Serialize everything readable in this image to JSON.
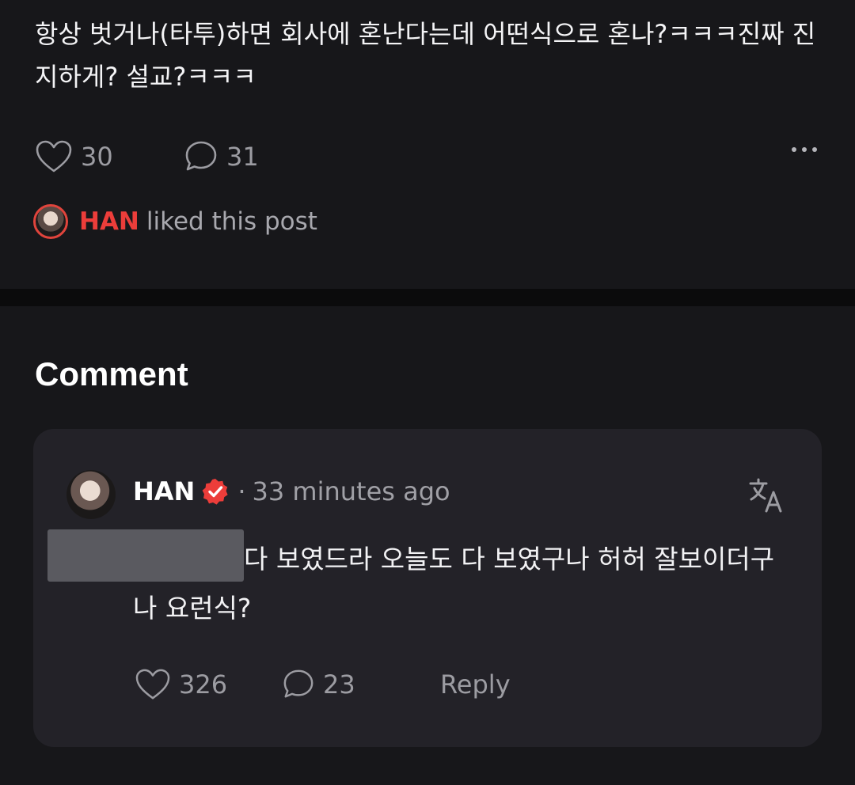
{
  "post": {
    "text": "항상 벗거나(타투)하면 회사에 혼난다는데 어떤식으로 혼나?ㅋㅋㅋ진짜 진지하게? 설교?ㅋㅋㅋ",
    "like_count": "30",
    "comment_count": "31",
    "liked_by": {
      "name": "HAN",
      "suffix": "liked this post",
      "accent_color": "#ec3d3a"
    }
  },
  "comments": {
    "title": "Comment",
    "items": [
      {
        "author": "HAN",
        "verified": true,
        "separator": "·",
        "time": "33 minutes ago",
        "text": "다 보였드라 오늘도 다 보였구나 허허 잘보이더구나 요런식?",
        "like_count": "326",
        "reply_count": "23",
        "reply_label": "Reply"
      }
    ]
  },
  "icons": {
    "like": "heart-outline-icon",
    "comment": "speech-bubble-icon",
    "more": "more-horizontal-icon",
    "verified": "verified-badge-icon",
    "translate": "translate-icon"
  },
  "colors": {
    "background": "#17171a",
    "card": "#232228",
    "verified_badge": "#ec3d3a"
  }
}
